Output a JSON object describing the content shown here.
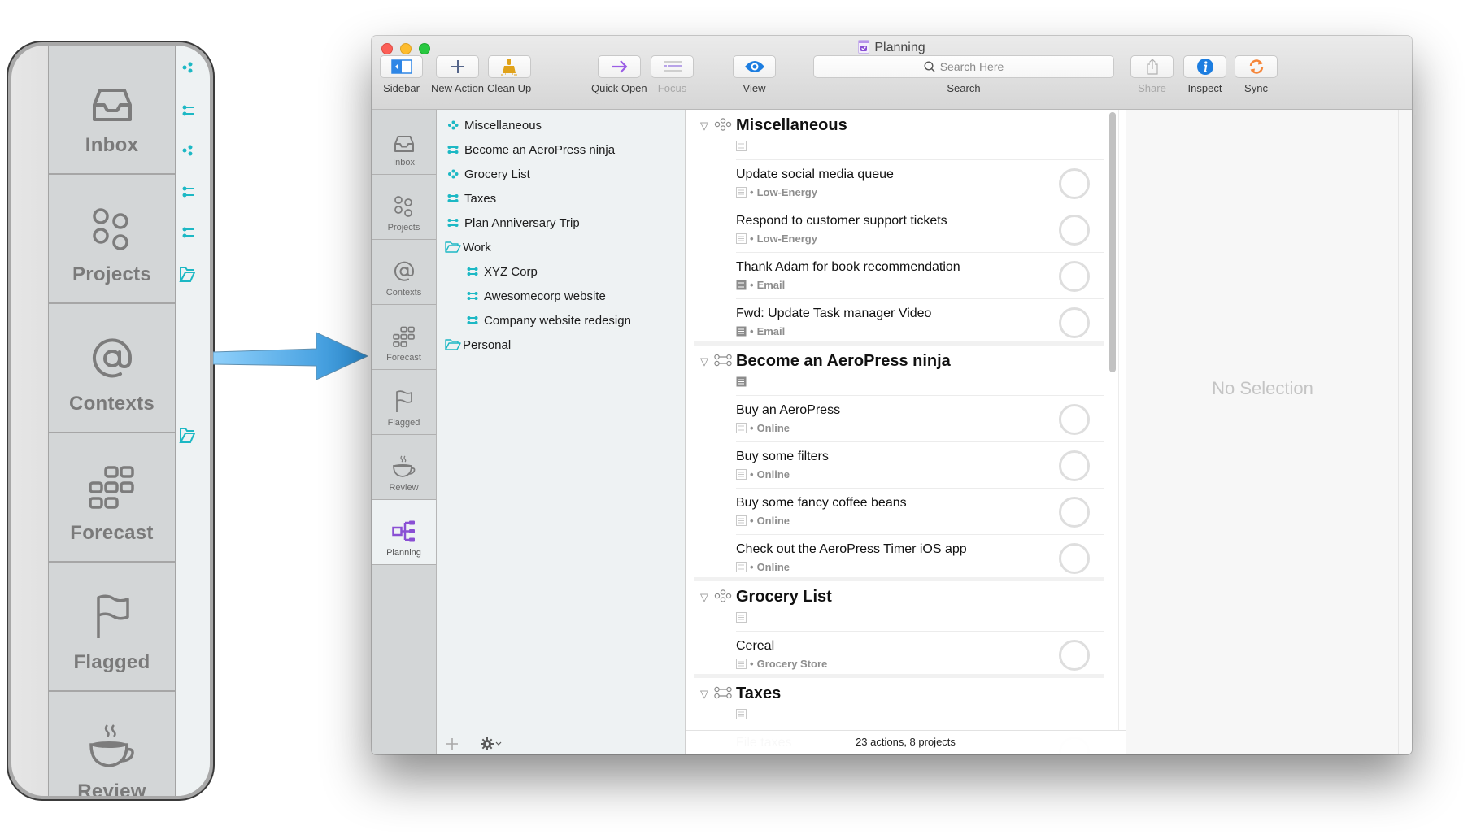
{
  "callout": {
    "tabs": [
      {
        "label": "Inbox",
        "icon": "inbox-icon"
      },
      {
        "label": "Projects",
        "icon": "projects-icon"
      },
      {
        "label": "Contexts",
        "icon": "contexts-icon"
      },
      {
        "label": "Forecast",
        "icon": "forecast-icon"
      },
      {
        "label": "Flagged",
        "icon": "flag-icon"
      },
      {
        "label": "Review",
        "icon": "review-coffee-icon"
      }
    ]
  },
  "window": {
    "title": "Planning",
    "toolbar": {
      "sidebar": "Sidebar",
      "new_action": "New Action",
      "clean_up": "Clean Up",
      "quick_open": "Quick Open",
      "focus": "Focus",
      "view": "View",
      "search_placeholder": "Search Here",
      "search_label": "Search",
      "share": "Share",
      "inspect": "Inspect",
      "sync": "Sync"
    },
    "colors": {
      "accent_teal": "#1cb8c4",
      "planning_purple": "#8a4fd4",
      "quick_open_purple": "#9b5de5",
      "clean_up_gold": "#e0a21a",
      "sync_orange": "#f5863a",
      "inspect_blue": "#1c7de0"
    },
    "sidebar_tabs": [
      {
        "label": "Inbox",
        "icon": "inbox-icon",
        "active": false
      },
      {
        "label": "Projects",
        "icon": "projects-icon",
        "active": false
      },
      {
        "label": "Contexts",
        "icon": "contexts-icon",
        "active": false
      },
      {
        "label": "Forecast",
        "icon": "forecast-icon",
        "active": false
      },
      {
        "label": "Flagged",
        "icon": "flag-icon",
        "active": false
      },
      {
        "label": "Review",
        "icon": "review-coffee-icon",
        "active": false
      },
      {
        "label": "Planning",
        "icon": "planning-icon",
        "active": true
      }
    ],
    "project_list": [
      {
        "label": "Miscellaneous",
        "type": "single-actions"
      },
      {
        "label": "Become an AeroPress ninja",
        "type": "sequential"
      },
      {
        "label": "Grocery List",
        "type": "single-actions"
      },
      {
        "label": "Taxes",
        "type": "sequential"
      },
      {
        "label": "Plan Anniversary Trip",
        "type": "sequential"
      },
      {
        "label": "Work",
        "type": "folder"
      },
      {
        "label": "XYZ Corp",
        "type": "sequential",
        "child": true
      },
      {
        "label": "Awesomecorp website",
        "type": "sequential",
        "child": true
      },
      {
        "label": "Company website redesign",
        "type": "sequential",
        "child": true
      },
      {
        "label": "Personal",
        "type": "folder"
      }
    ],
    "outline": {
      "sections": [
        {
          "title": "Miscellaneous",
          "type": "single-actions",
          "has_note": false,
          "tasks": [
            {
              "name": "Update social media queue",
              "context": "Low-Energy",
              "has_note": false
            },
            {
              "name": "Respond to customer support tickets",
              "context": "Low-Energy",
              "has_note": false
            },
            {
              "name": "Thank Adam for book recommendation",
              "context": "Email",
              "has_note": true
            },
            {
              "name": "Fwd: Update Task manager Video",
              "context": "Email",
              "has_note": true
            }
          ]
        },
        {
          "title": "Become an AeroPress ninja",
          "type": "sequential",
          "has_note": true,
          "tasks": [
            {
              "name": "Buy an AeroPress",
              "context": "Online",
              "has_note": false
            },
            {
              "name": "Buy some filters",
              "context": "Online",
              "has_note": false
            },
            {
              "name": "Buy some fancy coffee beans",
              "context": "Online",
              "has_note": false
            },
            {
              "name": "Check out the AeroPress Timer iOS app",
              "context": "Online",
              "has_note": false
            }
          ]
        },
        {
          "title": "Grocery List",
          "type": "single-actions",
          "has_note": false,
          "tasks": [
            {
              "name": "Cereal",
              "context": "Grocery Store",
              "has_note": false
            }
          ]
        },
        {
          "title": "Taxes",
          "type": "sequential",
          "has_note": false,
          "tasks": [
            {
              "name": "File taxes",
              "context": "",
              "has_note": false
            }
          ]
        }
      ],
      "status": "23 actions, 8 projects",
      "context_separator": "•"
    },
    "inspector": {
      "empty_label": "No Selection"
    }
  }
}
